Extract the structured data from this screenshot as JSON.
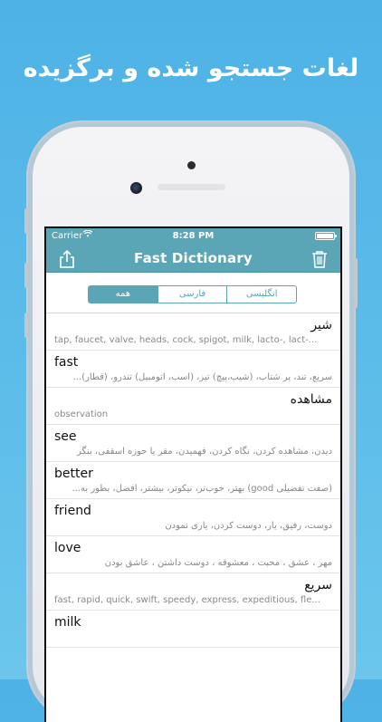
{
  "headline": "لغات جستجو شده و برگزیده",
  "status": {
    "carrier": "Carrier",
    "wifi_icon": "wifi-icon",
    "time": "8:28 PM",
    "battery_icon": "battery-icon"
  },
  "nav": {
    "title": "Fast Dictionary",
    "left_icon": "share-icon",
    "right_icon": "trash-icon"
  },
  "segments": {
    "english": "انگلیسی",
    "persian": "فارسی",
    "all": "همه",
    "selected": "all"
  },
  "entries": [
    {
      "word": "شیر",
      "definition": "tap, faucet, valve, heads, cock, spigot, milk, lacto-, lact-..."
    },
    {
      "word": "fast",
      "definition": "سریع، تند، پر شتاب، (شیب،پیچ) تیز، (اسب، اتومبیل) تندرو، (قطار)..."
    },
    {
      "word": "مشاهده",
      "definition": "observation"
    },
    {
      "word": "see",
      "definition": "دیدن، مشاهده کردن، نگاه کردن، فهمیدن، مقر یا حوزه اسقفی، بنگر"
    },
    {
      "word": "better",
      "definition": "(صفت تفضیلی good) بهتر، خوب‌تر، نیکوتر، بیشتر، افضل، بطور به..."
    },
    {
      "word": "friend",
      "definition": "دوست، رفیق، یار، دوست کردن، یاری نمودن"
    },
    {
      "word": "love",
      "definition": "مهر ، عشق ، محبت ، معشوقه ، دوست داشتن ، عاشق بودن"
    },
    {
      "word": "سریع",
      "definition": "fast, rapid, quick, swift, speedy, express, expeditious, fle..."
    },
    {
      "word": "milk",
      "definition": ""
    }
  ],
  "colors": {
    "background": "#5cbde9",
    "app_bar": "#5ba6b6",
    "accent": "#5ba6b6"
  }
}
